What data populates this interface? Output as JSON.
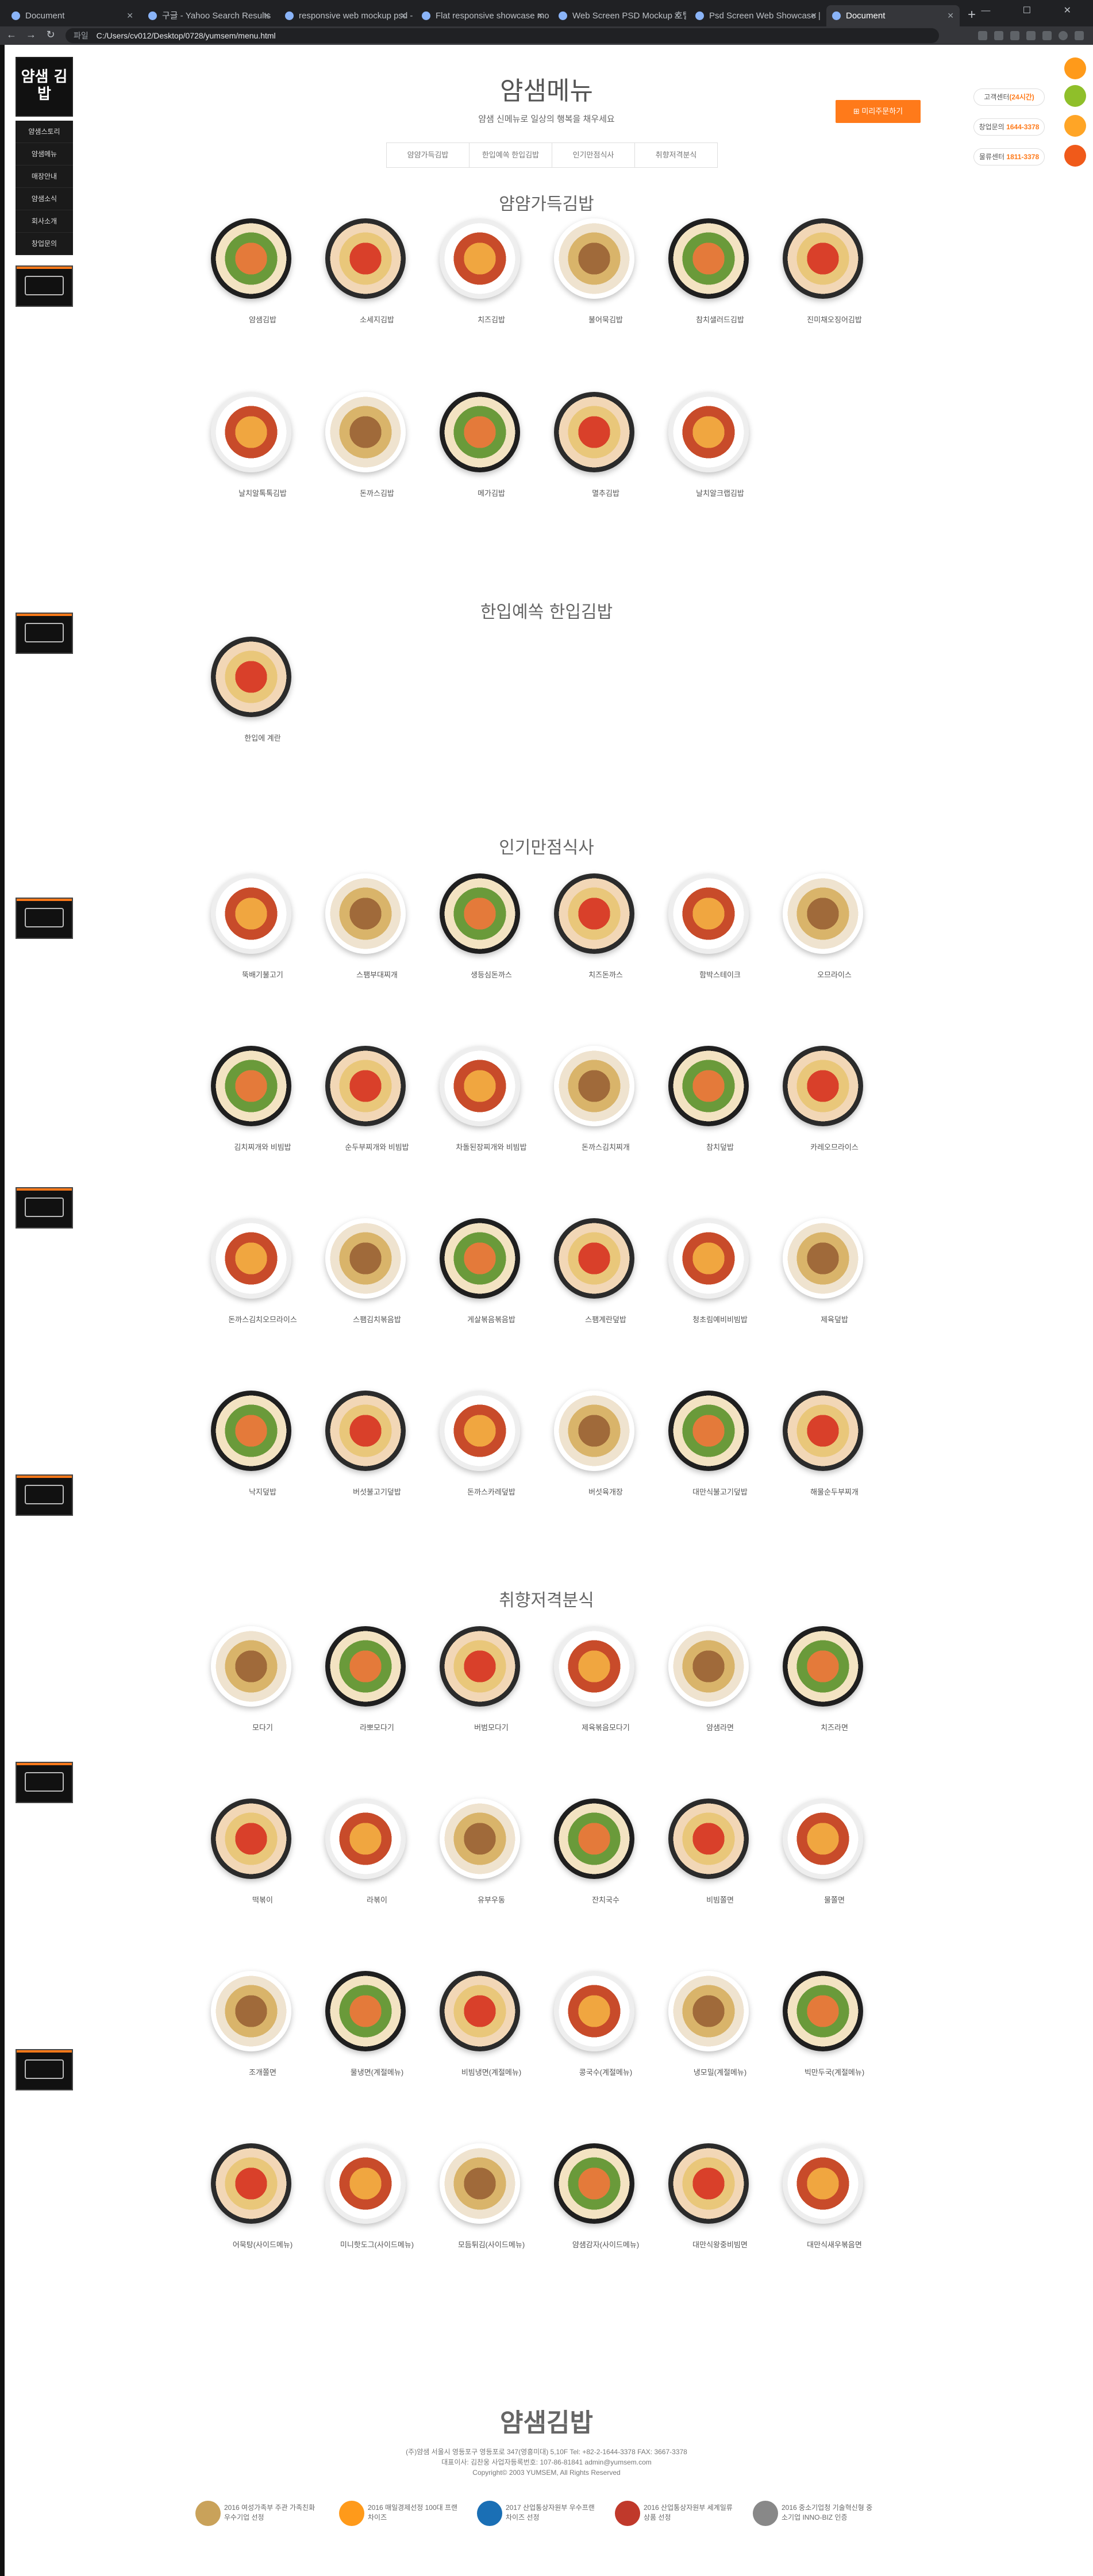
{
  "browser": {
    "tabs": [
      {
        "title": "Document",
        "active": false
      },
      {
        "title": "구글 - Yahoo Search Results",
        "active": false
      },
      {
        "title": "responsive web mockup psd -",
        "active": false
      },
      {
        "title": "Flat responsive showcase mock",
        "active": false
      },
      {
        "title": "Web Screen PSD Mockup 호텔",
        "active": false
      },
      {
        "title": "Psd Screen Web Showcase | F",
        "active": false
      },
      {
        "title": "Document",
        "active": true
      }
    ],
    "address_label": "파일",
    "address": "C:/Users/cv012/Desktop/0728/yumsem/menu.html"
  },
  "site": {
    "logo_text": "얌샘 김밥",
    "side_menu": [
      "얌샘스토리",
      "얌샘메뉴",
      "매장안내",
      "얌샘소식",
      "회사소개",
      "창업문의"
    ]
  },
  "header": {
    "title": "얌샘메뉴",
    "subtitle": "얌샘 신메뉴로 일상의 행복을 채우세요",
    "tabs": [
      "얌얌가득김밥",
      "한입예쏙 한입김밥",
      "인기만점식사",
      "취향저격분식"
    ],
    "order_button": "미리주문하기"
  },
  "side_info": [
    {
      "prefix": "고객센터",
      "highlight": "(24시간)"
    },
    {
      "prefix": "창업문의",
      "highlight": "1644-3378"
    },
    {
      "prefix": "물류센터",
      "highlight": "1811-3378"
    }
  ],
  "sections": [
    {
      "title": "얌얌가득김밥",
      "items": [
        "얌샘김밥",
        "소세지김밥",
        "치즈김밥",
        "불어묵김밥",
        "참치샐러드김밥",
        "진미채오징어김밥",
        "날치알톡톡김밥",
        "돈까스김밥",
        "메가김밥",
        "멸추김밥",
        "날치알크랩김밥"
      ]
    },
    {
      "title": "한입예쏙 한입김밥",
      "items": [
        "한입에 계란"
      ]
    },
    {
      "title": "인기만점식사",
      "items": [
        "뚝배기불고기",
        "스팸부대찌개",
        "생등심돈까스",
        "치즈돈까스",
        "함박스테이크",
        "오므라이스",
        "김치찌개와 비빔밥",
        "순두부찌개와 비빔밥",
        "차돌된장찌개와 비빔밥",
        "돈까스김치찌개",
        "참치덮밥",
        "카레오므라이스",
        "돈까스김치오므라이스",
        "스팸김치볶음밥",
        "게살볶음볶음밥",
        "스팸계란덮밥",
        "청초림예비비빔밥",
        "제육덮밥",
        "낙지덮밥",
        "버섯불고기덮밥",
        "돈까스카레덮밥",
        "버섯육개장",
        "대만식불고기덮밥",
        "해물순두부찌개"
      ]
    },
    {
      "title": "취향저격분식",
      "items": [
        "모다기",
        "라뽀모다기",
        "버범모다기",
        "제육볶음모다기",
        "얌샘라면",
        "치즈라면",
        "떡볶이",
        "라볶이",
        "유부우동",
        "잔치국수",
        "비빔쫄면",
        "물쫄면",
        "조개쫄면",
        "물냉면(계절메뉴)",
        "비빔냉면(계절메뉴)",
        "콩국수(계절메뉴)",
        "냉모밀(계절메뉴)",
        "빅만두국(계절메뉴)",
        "어묵탕(사이드메뉴)",
        "미니핫도그(사이드메뉴)",
        "모듬튀김(사이드메뉴)",
        "얌샘감자(사이드메뉴)",
        "대만식왕중비빔면",
        "대만식새우볶음면"
      ]
    }
  ],
  "footer": {
    "logo_text": "얌샘김밥",
    "lines": [
      "(주)얌샘 서울시 영등포구 영등포로 347(영흥미대) 5,10F  Tel: +82-2-1644-3378  FAX: 3667-3378",
      "대표이사: 김찬웅 사업자등록번호: 107-86-81841  admin@yumsem.com",
      "Copyright© 2003 YUMSEM, All Rights Reserved"
    ],
    "awards": [
      {
        "text": "2016 여성가족부 주관 가족친화우수기업 선정"
      },
      {
        "text": "2016 매일경제선정 100대 프랜차이즈"
      },
      {
        "text": "2017 산업통상자원부 우수프랜차이즈 선정"
      },
      {
        "text": "2016 산업통상자원부 세계일류상품 선정"
      },
      {
        "text": "2016 중소기업청 기술혁신형 중소기업 INNO-BIZ 인증"
      }
    ]
  },
  "colors": {
    "accent": "#ff7a1a",
    "dark": "#111111"
  }
}
